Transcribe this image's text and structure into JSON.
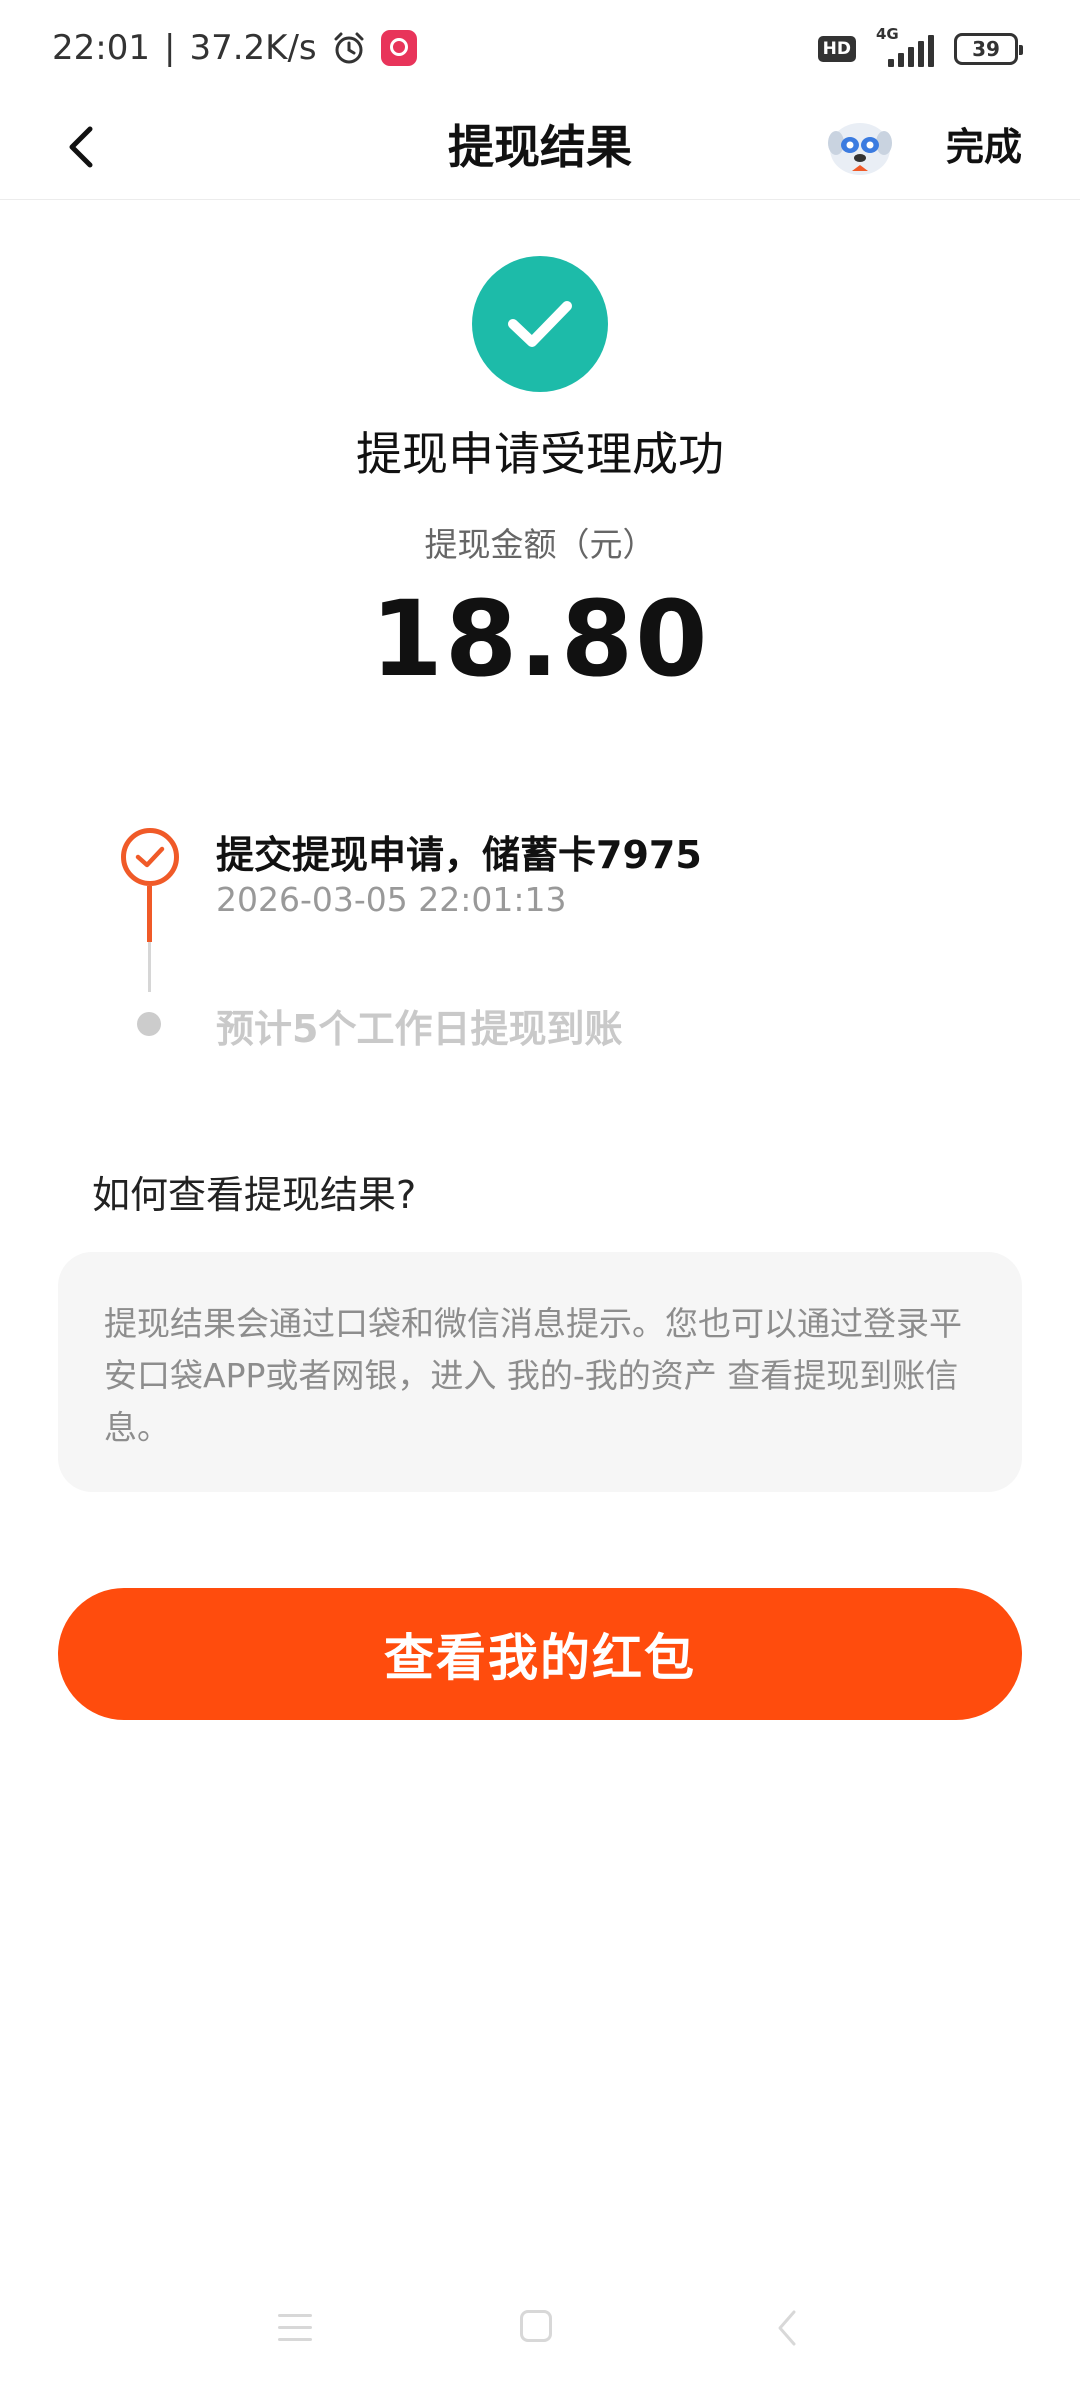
{
  "status_bar": {
    "time": "22:01",
    "speed": "37.2K/s",
    "hd": "HD",
    "network": "4G",
    "battery": "39",
    "icons": [
      "alarm-icon",
      "app-notification-icon",
      "hd-icon",
      "signal-icon",
      "battery-icon"
    ]
  },
  "nav": {
    "title": "提现结果",
    "done_label": "完成",
    "back_icon": "chevron-left-icon",
    "mascot_icon": "mascot-avatar-icon"
  },
  "result": {
    "status_icon": "check-circle-icon",
    "status_text": "提现申请受理成功",
    "amount_label": "提现金额（元）",
    "amount": "18.80"
  },
  "timeline": [
    {
      "title": "提交提现申请，储蓄卡7975",
      "time": "2026-03-05 22:01:13",
      "state": "done"
    },
    {
      "title": "预计5个工作日提现到账",
      "state": "pending"
    }
  ],
  "help": {
    "title": "如何查看提现结果?",
    "body": "提现结果会通过口袋和微信消息提示。您也可以通过登录平安口袋APP或者网银，进入 我的-我的资产 查看提现到账信息。"
  },
  "cta": {
    "label": "查看我的红包"
  },
  "colors": {
    "success": "#1dbba9",
    "accent_orange": "#f05a28",
    "cta_bg": "#ff4c0d",
    "muted_text": "#999999"
  }
}
